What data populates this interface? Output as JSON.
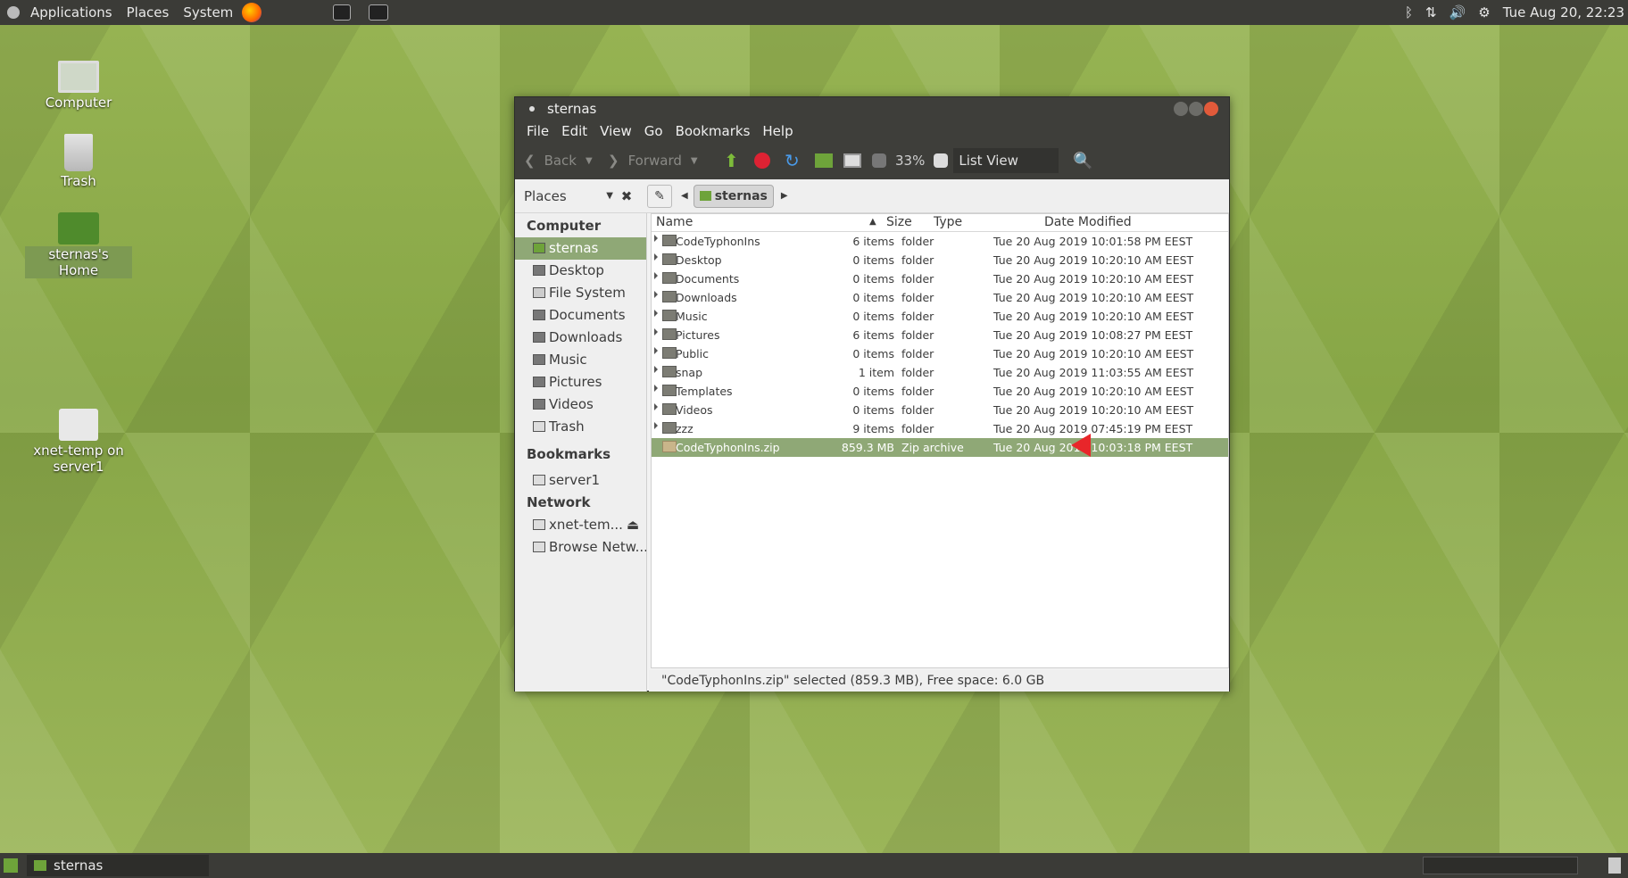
{
  "top_panel": {
    "applications": "Applications",
    "places": "Places",
    "system": "System",
    "clock": "Tue Aug 20, 22:23"
  },
  "desktop_icons": {
    "computer": "Computer",
    "trash": "Trash",
    "home": "sternas's Home",
    "share_line1": "xnet-temp on",
    "share_line2": "server1"
  },
  "window": {
    "title": "sternas",
    "menu": {
      "file": "File",
      "edit": "Edit",
      "view": "View",
      "go": "Go",
      "bookmarks": "Bookmarks",
      "help": "Help"
    },
    "toolbar": {
      "back": "Back",
      "forward": "Forward",
      "zoom": "33%",
      "view_mode": "List View"
    },
    "location": {
      "places_label": "Places",
      "current": "sternas"
    },
    "sidebar": {
      "computer_heading": "Computer",
      "bookmarks_heading": "Bookmarks",
      "network_heading": "Network",
      "items": [
        "sternas",
        "Desktop",
        "File System",
        "Documents",
        "Downloads",
        "Music",
        "Pictures",
        "Videos",
        "Trash"
      ],
      "bookmarks": [
        "server1"
      ],
      "network": [
        "xnet-tem...",
        "Browse Netw..."
      ]
    },
    "columns": {
      "name": "Name",
      "size": "Size",
      "type": "Type",
      "date": "Date Modified"
    },
    "files": [
      {
        "name": "CodeTyphonIns",
        "size": "6 items",
        "type": "folder",
        "date": "Tue 20 Aug 2019 10:01:58 PM EEST"
      },
      {
        "name": "Desktop",
        "size": "0 items",
        "type": "folder",
        "date": "Tue 20 Aug 2019 10:20:10 AM EEST"
      },
      {
        "name": "Documents",
        "size": "0 items",
        "type": "folder",
        "date": "Tue 20 Aug 2019 10:20:10 AM EEST"
      },
      {
        "name": "Downloads",
        "size": "0 items",
        "type": "folder",
        "date": "Tue 20 Aug 2019 10:20:10 AM EEST"
      },
      {
        "name": "Music",
        "size": "0 items",
        "type": "folder",
        "date": "Tue 20 Aug 2019 10:20:10 AM EEST"
      },
      {
        "name": "Pictures",
        "size": "6 items",
        "type": "folder",
        "date": "Tue 20 Aug 2019 10:08:27 PM EEST"
      },
      {
        "name": "Public",
        "size": "0 items",
        "type": "folder",
        "date": "Tue 20 Aug 2019 10:20:10 AM EEST"
      },
      {
        "name": "snap",
        "size": "1 item",
        "type": "folder",
        "date": "Tue 20 Aug 2019 11:03:55 AM EEST"
      },
      {
        "name": "Templates",
        "size": "0 items",
        "type": "folder",
        "date": "Tue 20 Aug 2019 10:20:10 AM EEST"
      },
      {
        "name": "Videos",
        "size": "0 items",
        "type": "folder",
        "date": "Tue 20 Aug 2019 10:20:10 AM EEST"
      },
      {
        "name": "zzz",
        "size": "9 items",
        "type": "folder",
        "date": "Tue 20 Aug 2019 07:45:19 PM EEST"
      },
      {
        "name": "CodeTyphonIns.zip",
        "size": "859.3 MB",
        "type": "Zip archive",
        "date": "Tue 20 Aug 2019 10:03:18 PM EEST"
      }
    ],
    "status": "\"CodeTyphonIns.zip\" selected (859.3 MB), Free space: 6.0 GB"
  },
  "taskbar": {
    "task": "sternas"
  },
  "colors": {
    "accent": "#8fa876",
    "panel": "#3b3b37",
    "arrow": "#e8262a"
  }
}
